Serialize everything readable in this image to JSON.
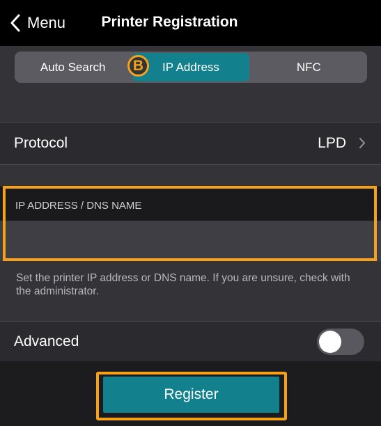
{
  "navbar": {
    "back_label": "Menu",
    "title": "Printer Registration"
  },
  "segmented_control": {
    "items": [
      "Auto Search",
      "IP Address",
      "NFC"
    ],
    "selected": "IP Address",
    "callout": "B"
  },
  "protocol": {
    "label": "Protocol",
    "value": "LPD"
  },
  "ip_address": {
    "header": "IP ADDRESS / DNS NAME",
    "value": "",
    "help": "Set the printer IP address or DNS name. If you are unsure, check with the administrator."
  },
  "advanced": {
    "label": "Advanced",
    "enabled": false
  },
  "footer": {
    "register_label": "Register"
  },
  "colors": {
    "accent": "#13818d",
    "highlight": "#f4a11c",
    "background": "#333338"
  },
  "icons": {
    "back": "chevron-left-icon",
    "protocol_disclosure": "chevron-right-icon"
  }
}
